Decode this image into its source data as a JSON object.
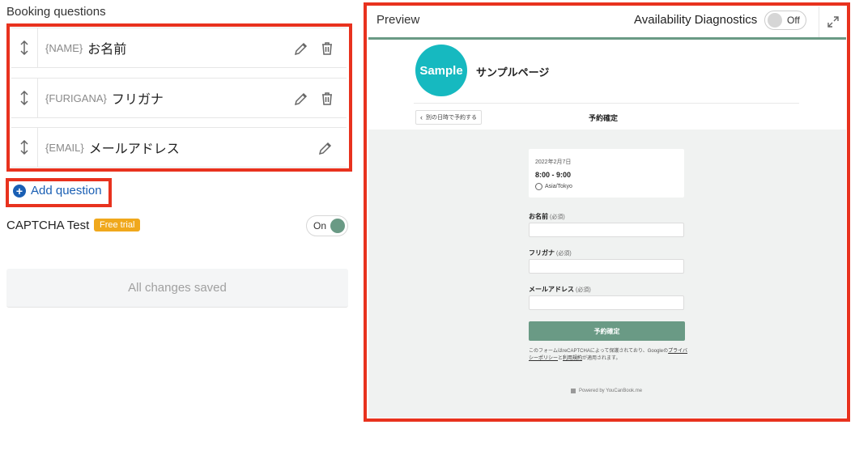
{
  "left": {
    "title": "Booking questions",
    "questions": [
      {
        "token": "{NAME}",
        "label": "お名前"
      },
      {
        "token": "{FURIGANA}",
        "label": "フリガナ"
      },
      {
        "token": "{EMAIL}",
        "label": "メールアドレス"
      }
    ],
    "add_question": "Add question",
    "captcha_label": "CAPTCHA Test",
    "trial_badge": "Free trial",
    "captcha_toggle": "On",
    "save_status": "All changes saved"
  },
  "preview": {
    "title": "Preview",
    "diagnostics_label": "Availability Diagnostics",
    "diagnostics_toggle": "Off",
    "logo_text": "Sample",
    "page_name": "サンプルページ",
    "back_button": "別の日時で予約する",
    "confirm_title": "予約確定",
    "date": "2022年2月7日",
    "time": "8:00 - 9:00",
    "timezone": "Asia/Tokyo",
    "fields": [
      {
        "label": "お名前",
        "req": "(必須)"
      },
      {
        "label": "フリガナ",
        "req": "(必須)"
      },
      {
        "label": "メールアドレス",
        "req": "(必須)"
      }
    ],
    "submit": "予約確定",
    "note_pre": "このフォームはreCAPTCHAによって保護されており、Googleの",
    "note_link1": "プライバシーポリシー",
    "note_mid": "と",
    "note_link2": "利用規約",
    "note_post": "が適用されます。",
    "powered": "Powered by YouCanBook.me"
  },
  "colors": {
    "highlight": "#e8321e",
    "accent": "#6a9a85",
    "link": "#1a5fb4",
    "badge": "#f0a81c",
    "logo": "#16b9c0"
  }
}
